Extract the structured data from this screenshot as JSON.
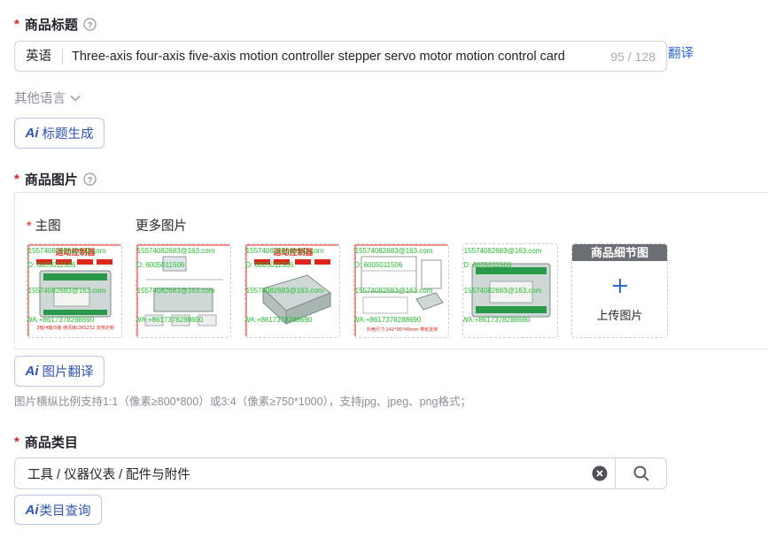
{
  "title_section": {
    "label": "商品标题",
    "lang_tag": "英语",
    "value": "Three-axis four-axis five-axis motion controller stepper servo motor motion control card",
    "counter": "95 / 128",
    "translate_link": "翻译",
    "other_languages": "其他语言",
    "ai_title_button": "标题生成"
  },
  "image_section": {
    "label": "商品图片",
    "main_label": "主图",
    "more_label": "更多图片",
    "thumbnails": [
      {
        "banner": "运动控制器",
        "watermark_email": "r15574082683@163.com",
        "watermark_id": "ID: 6005011506",
        "watermark_wa": "WA:+8617378288690"
      },
      {
        "banner": "",
        "watermark_email": "r15574082683@163.com",
        "watermark_id": "ID: 6005011506",
        "watermark_wa": "WA:+8617378288690"
      },
      {
        "banner": "运动控制器",
        "watermark_email": "r15574082683@163.com",
        "watermark_id": "ID: 6005011506",
        "watermark_wa": "WA:+8617378288690"
      },
      {
        "banner": "",
        "watermark_email": "r15574082683@163.com",
        "watermark_id": "ID: 6005011506",
        "watermark_wa": "WA:+8617378288690"
      },
      {
        "banner": "",
        "watermark_email": "r15574082683@163.com",
        "watermark_id": "ID: 6005011506",
        "watermark_wa": "WA:+8617378288690"
      }
    ],
    "detail_header": "商品细节图",
    "upload_label": "上传图片",
    "ai_translate_button": "图片翻译",
    "hint": "图片横纵比例支持1:1（像素≥800*800）或3:4（像素≥750*1000），支持jpg、jpeg、png格式；"
  },
  "category_section": {
    "label": "商品类目",
    "value": "工具 / 仪器仪表 / 配件与附件",
    "ai_query_button": "类目查询"
  },
  "ai_mark": "Ai",
  "colors": {
    "required": "#e0251d",
    "link": "#2f6bd6",
    "ai_button": "#2f55b4",
    "watermark": "#22c02a"
  }
}
